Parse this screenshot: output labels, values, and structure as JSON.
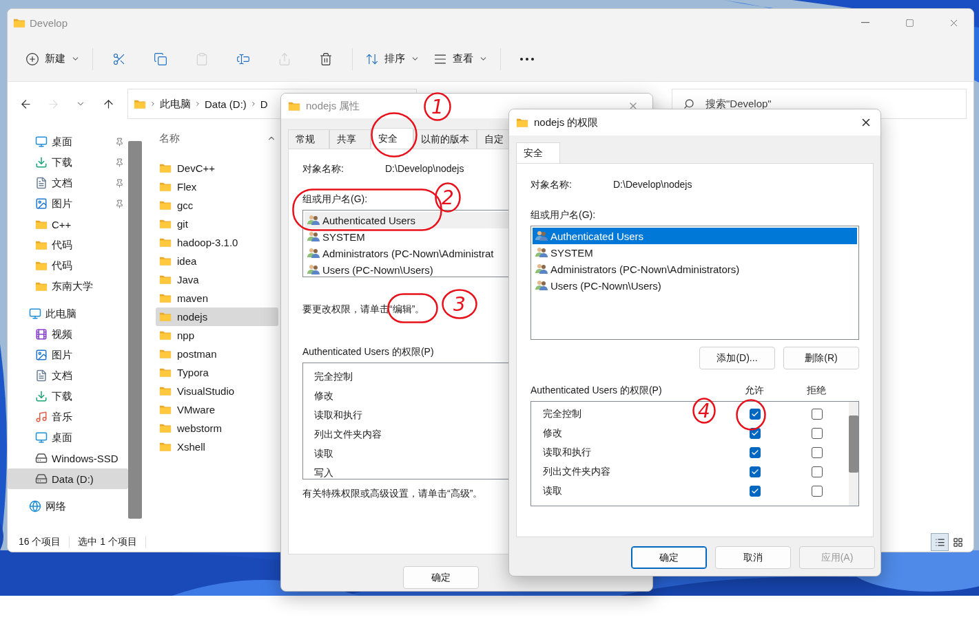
{
  "explorer": {
    "title": "Develop",
    "active": false,
    "window_controls": [
      {
        "kind": "minimize"
      },
      {
        "kind": "maximize"
      },
      {
        "kind": "close"
      }
    ],
    "toolbar": [
      {
        "kind": "new",
        "label": "新建",
        "disabled": false
      },
      {
        "kind": "cut",
        "disabled": false
      },
      {
        "kind": "copy",
        "disabled": false
      },
      {
        "kind": "paste",
        "disabled": true
      },
      {
        "kind": "rename",
        "disabled": false
      },
      {
        "kind": "share",
        "disabled": true
      },
      {
        "kind": "delete",
        "disabled": false
      },
      {
        "kind": "sort",
        "label": "排序",
        "disabled": false
      },
      {
        "kind": "view",
        "label": "查看",
        "disabled": false
      },
      {
        "kind": "more",
        "disabled": false
      }
    ],
    "nav": [
      {
        "kind": "back",
        "disabled": false
      },
      {
        "kind": "forward",
        "disabled": true
      },
      {
        "kind": "recent",
        "disabled": false
      },
      {
        "kind": "up",
        "disabled": false
      }
    ],
    "breadcrumb": [
      "此电脑",
      "Data (D:)",
      "D"
    ],
    "search": {
      "placeholder": "搜索\"Develop\""
    },
    "quick_access": [
      {
        "label": "桌面",
        "kind": "desktop",
        "pinned": true,
        "selected": false
      },
      {
        "label": "下载",
        "kind": "download",
        "pinned": true,
        "selected": false
      },
      {
        "label": "文档",
        "kind": "document",
        "pinned": true,
        "selected": false
      },
      {
        "label": "图片",
        "kind": "pictures",
        "pinned": true,
        "selected": false
      },
      {
        "label": "C++",
        "kind": "folder",
        "pinned": false,
        "selected": false
      },
      {
        "label": "代码",
        "kind": "folder",
        "pinned": false,
        "selected": false
      },
      {
        "label": "代码",
        "kind": "folder",
        "pinned": false,
        "selected": false
      },
      {
        "label": "东南大学",
        "kind": "folder",
        "pinned": false,
        "selected": false
      }
    ],
    "tree": [
      {
        "label": "此电脑",
        "kind": "pc",
        "selected": false,
        "children": [
          {
            "label": "视频",
            "kind": "video",
            "selected": false
          },
          {
            "label": "图片",
            "kind": "pictures",
            "selected": false
          },
          {
            "label": "文档",
            "kind": "document",
            "selected": false
          },
          {
            "label": "下载",
            "kind": "download",
            "selected": false
          },
          {
            "label": "音乐",
            "kind": "music",
            "selected": false
          },
          {
            "label": "桌面",
            "kind": "desktop",
            "selected": false
          },
          {
            "label": "Windows-SSD",
            "kind": "system-drive",
            "selected": false
          },
          {
            "label": "Data (D:)",
            "kind": "drive",
            "selected": true
          }
        ]
      },
      {
        "label": "网络",
        "kind": "network",
        "selected": false
      }
    ],
    "column_header": "名称",
    "files": [
      {
        "name": "DevC++",
        "selected": false
      },
      {
        "name": "Flex",
        "selected": false
      },
      {
        "name": "gcc",
        "selected": false
      },
      {
        "name": "git",
        "selected": false
      },
      {
        "name": "hadoop-3.1.0",
        "selected": false
      },
      {
        "name": "idea",
        "selected": false
      },
      {
        "name": "Java",
        "selected": false
      },
      {
        "name": "maven",
        "selected": false
      },
      {
        "name": "nodejs",
        "selected": true
      },
      {
        "name": "npp",
        "selected": false
      },
      {
        "name": "postman",
        "selected": false
      },
      {
        "name": "Typora",
        "selected": false
      },
      {
        "name": "VisualStudio",
        "selected": false
      },
      {
        "name": "VMware",
        "selected": false
      },
      {
        "name": "webstorm",
        "selected": false
      },
      {
        "name": "Xshell",
        "selected": false
      }
    ],
    "status_bar": [
      "16 个项目",
      "选中 1 个项目"
    ],
    "view_buttons": [
      {
        "kind": "details",
        "selected": true
      },
      {
        "kind": "tiles",
        "selected": false
      }
    ]
  },
  "properties": {
    "title": "nodejs 属性",
    "active": false,
    "tabs": [
      {
        "label": "常规",
        "selected": false
      },
      {
        "label": "共享",
        "selected": false
      },
      {
        "label": "安全",
        "selected": true
      },
      {
        "label": "以前的版本",
        "selected": false
      },
      {
        "label": "自定",
        "selected": false
      }
    ],
    "object_label": "对象名称:",
    "object_value": "D:\\Develop\\nodejs",
    "groups_label": "组或用户名(G):",
    "groups": [
      {
        "name": "Authenticated Users",
        "selected": true
      },
      {
        "name": "SYSTEM",
        "selected": false
      },
      {
        "name": "Administrators (PC-Nown\\Administrat",
        "selected": false
      },
      {
        "name": "Users (PC-Nown\\Users)",
        "selected": false
      }
    ],
    "edit_hint": "要更改权限，请单击“编辑”。",
    "permissions_label": "Authenticated Users 的权限(P)",
    "permissions": [
      "完全控制",
      "修改",
      "读取和执行",
      "列出文件夹内容",
      "读取",
      "写入"
    ],
    "advanced_hint": "有关特殊权限或高级设置，请单击“高级”。",
    "buttons": [
      {
        "label": "确定"
      }
    ]
  },
  "permissions_dialog": {
    "title": "nodejs 的权限",
    "active": true,
    "tabs": [
      {
        "label": "安全",
        "selected": true
      }
    ],
    "object_label": "对象名称:",
    "object_value": "D:\\Develop\\nodejs",
    "groups_label": "组或用户名(G):",
    "groups": [
      {
        "name": "Authenticated Users",
        "selected": true
      },
      {
        "name": "SYSTEM",
        "selected": false
      },
      {
        "name": "Administrators (PC-Nown\\Administrators)",
        "selected": false
      },
      {
        "name": "Users (PC-Nown\\Users)",
        "selected": false
      }
    ],
    "group_buttons": [
      "添加(D)...",
      "删除(R)"
    ],
    "permissions_label": "Authenticated Users 的权限(P)",
    "allow_header": "允许",
    "deny_header": "拒绝",
    "permissions": [
      {
        "label": "完全控制",
        "allow": true,
        "deny": false
      },
      {
        "label": "修改",
        "allow": true,
        "deny": false
      },
      {
        "label": "读取和执行",
        "allow": true,
        "deny": false
      },
      {
        "label": "列出文件夹内容",
        "allow": true,
        "deny": false
      },
      {
        "label": "读取",
        "allow": true,
        "deny": false
      }
    ],
    "buttons": [
      {
        "label": "确定",
        "default": true,
        "disabled": false
      },
      {
        "label": "取消",
        "default": false,
        "disabled": false
      },
      {
        "label": "应用(A)",
        "default": false,
        "disabled": true
      }
    ]
  },
  "annotations": [
    {
      "label": "1"
    },
    {
      "label": "2"
    },
    {
      "label": "3"
    },
    {
      "label": "4"
    }
  ]
}
